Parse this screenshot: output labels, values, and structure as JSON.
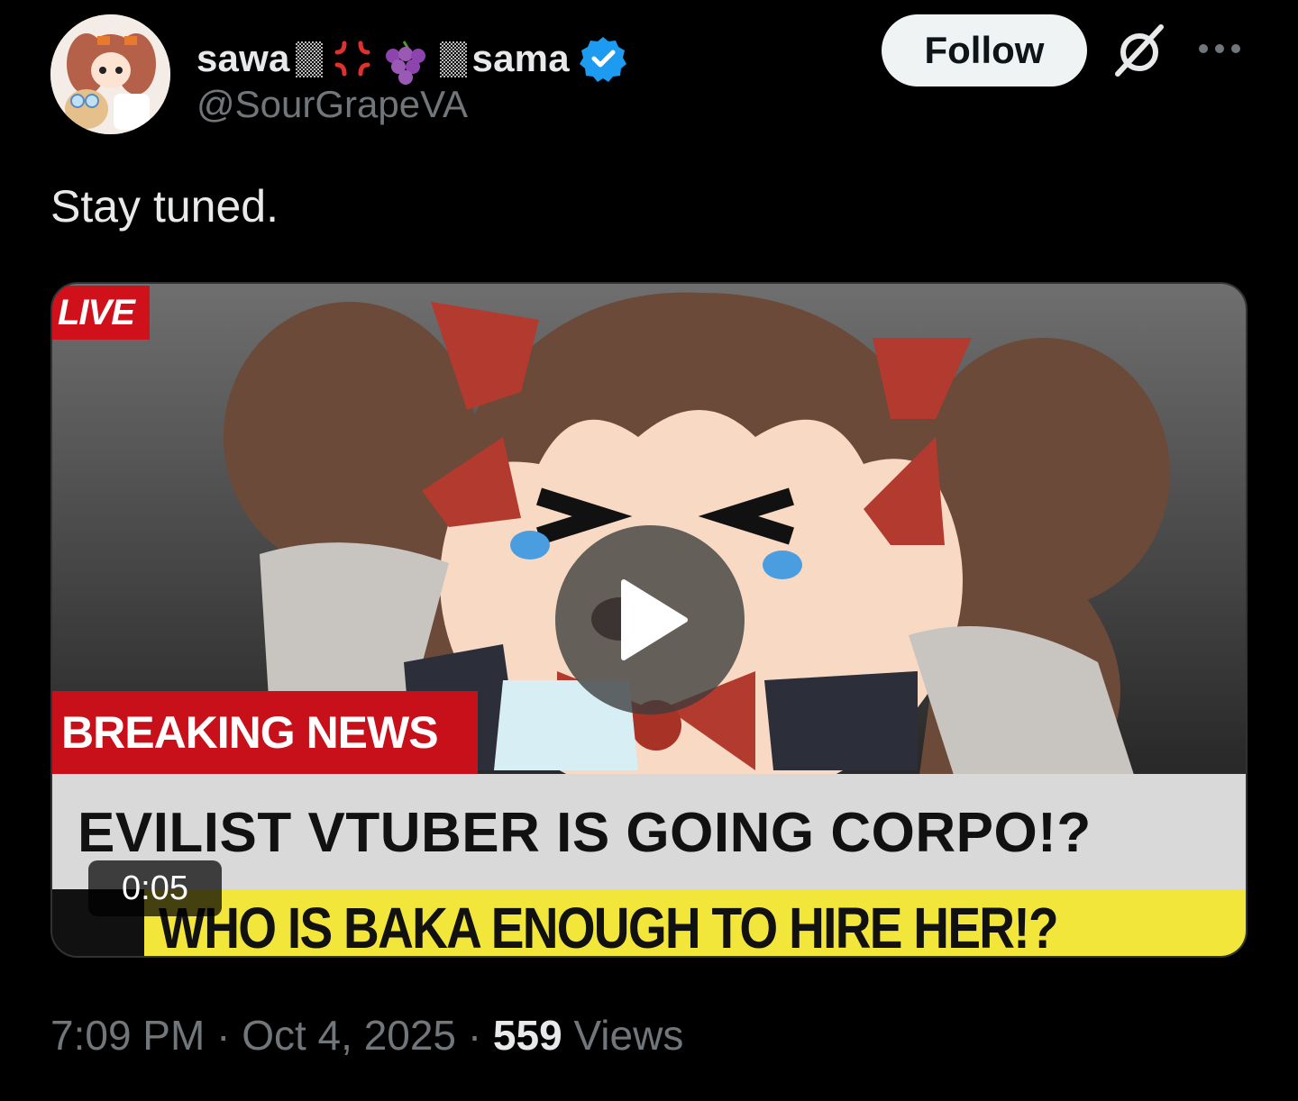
{
  "author": {
    "display_name_prefix": "sawa",
    "display_name_suffix": "sama",
    "handle": "@SourGrapeVA",
    "verified": true,
    "verified_color": "#1d9bf0"
  },
  "actions": {
    "follow_label": "Follow"
  },
  "tweet": {
    "text": "Stay tuned."
  },
  "media": {
    "live_label": "LIVE",
    "breaking_label": "BREAKING NEWS",
    "headline": "EVILIST VTUBER IS GOING CORPO!?",
    "ticker": "WHO IS BAKA ENOUGH TO HIRE HER!?",
    "duration": "0:05"
  },
  "footer": {
    "time": "7:09 PM",
    "date": "Oct 4, 2025",
    "separator": "·",
    "views_count": "559",
    "views_label": "Views"
  }
}
